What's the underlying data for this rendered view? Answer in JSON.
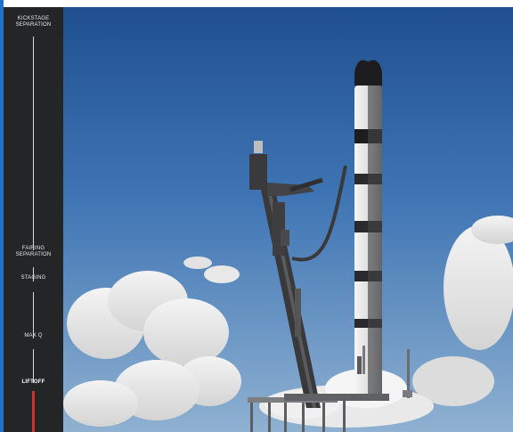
{
  "frame": {
    "milestones": [
      {
        "label_line1": "KICKSTAGE",
        "label_line2": "SEPARATION"
      },
      {
        "label_line1": "FAIRING",
        "label_line2": "SEPARATION"
      },
      {
        "label_line1": "STAGING",
        "label_line2": ""
      },
      {
        "label_line1": "MAX Q",
        "label_line2": ""
      },
      {
        "label_line1": "LIFTOFF",
        "label_line2": ""
      }
    ],
    "current_milestone": "LIFTOFF",
    "colors": {
      "sidebar": "#242526",
      "progress": "#d1332d",
      "sky_top": "#2d5f9f",
      "sky_bottom": "#8fb2d2"
    }
  }
}
